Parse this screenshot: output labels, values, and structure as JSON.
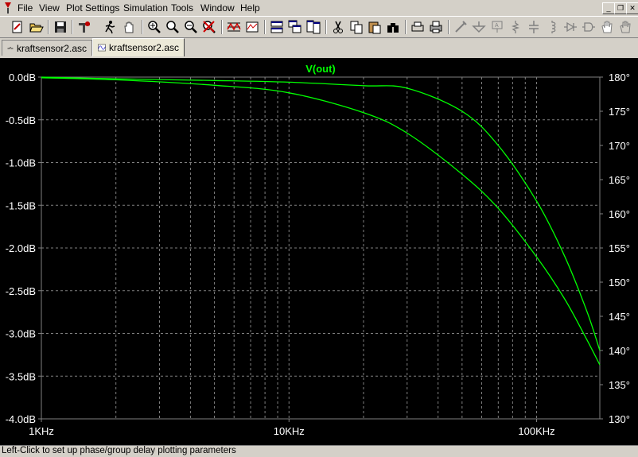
{
  "menu": [
    "File",
    "View",
    "Plot Settings",
    "Simulation",
    "Tools",
    "Window",
    "Help"
  ],
  "tabs": [
    {
      "label": "kraftsensor2.asc",
      "icon": "schematic-icon"
    },
    {
      "label": "kraftsensor2.asc",
      "icon": "waveform-icon"
    }
  ],
  "toolbar_icons": [
    "new-schematic-icon",
    "open-icon",
    "save-icon",
    "control-panel-icon",
    "run-icon",
    "halt-icon",
    "zoom-in-icon",
    "zoom-area-icon",
    "zoom-out-icon",
    "zoom-cancel-icon",
    "autoscale-icon",
    "pick-visible-traces-icon",
    "tile-horizontal-icon",
    "cascade-icon",
    "tile-vertical-icon",
    "cut-icon",
    "copy-icon",
    "paste-icon",
    "find-icon",
    "print-setup-icon",
    "print-icon",
    "wire-icon",
    "ground-icon",
    "label-net-icon",
    "resistor-icon",
    "capacitor-icon",
    "inductor-icon",
    "diode-icon",
    "component-icon",
    "move-icon",
    "drag-icon"
  ],
  "statusbar": {
    "text": "Left-Click to set up phase/group delay plotting parameters"
  },
  "colors": {
    "background": "#000000",
    "trace": "#00ff00",
    "grid": "#808080",
    "axis_text": "#ffffff"
  },
  "chart_data": {
    "type": "line",
    "title": "V(out)",
    "x_scale": "log",
    "xlim": [
      1000,
      180000
    ],
    "x_ticks": [
      {
        "value": 1000,
        "label": "1KHz"
      },
      {
        "value": 10000,
        "label": "10KHz"
      },
      {
        "value": 100000,
        "label": "100KHz"
      }
    ],
    "ylim": [
      -4.0,
      0.0
    ],
    "y_ticks": [
      "0.0dB",
      "-0.5dB",
      "-1.0dB",
      "-1.5dB",
      "-2.0dB",
      "-2.5dB",
      "-3.0dB",
      "-3.5dB",
      "-4.0dB"
    ],
    "y2lim": [
      130,
      180
    ],
    "y2_ticks": [
      "180°",
      "175°",
      "170°",
      "165°",
      "160°",
      "155°",
      "150°",
      "145°",
      "140°",
      "135°",
      "130°"
    ],
    "grid": true,
    "series": [
      {
        "axis": "left",
        "values": [
          [
            1000,
            0.0
          ],
          [
            2000,
            -0.02
          ],
          [
            5000,
            -0.04
          ],
          [
            10000,
            -0.06
          ],
          [
            20000,
            -0.1
          ],
          [
            30000,
            -0.13
          ],
          [
            50000,
            -0.4
          ],
          [
            70000,
            -0.8
          ],
          [
            100000,
            -1.45
          ],
          [
            130000,
            -2.1
          ],
          [
            160000,
            -2.75
          ],
          [
            180000,
            -3.2
          ]
        ]
      },
      {
        "axis": "right",
        "values": [
          [
            1000,
            179.9
          ],
          [
            2000,
            179.6
          ],
          [
            5000,
            178.8
          ],
          [
            10000,
            177.7
          ],
          [
            20000,
            174.8
          ],
          [
            30000,
            171.8
          ],
          [
            50000,
            165.8
          ],
          [
            70000,
            160.8
          ],
          [
            100000,
            153.7
          ],
          [
            130000,
            147.5
          ],
          [
            160000,
            141.5
          ],
          [
            180000,
            137.9
          ]
        ]
      }
    ]
  }
}
